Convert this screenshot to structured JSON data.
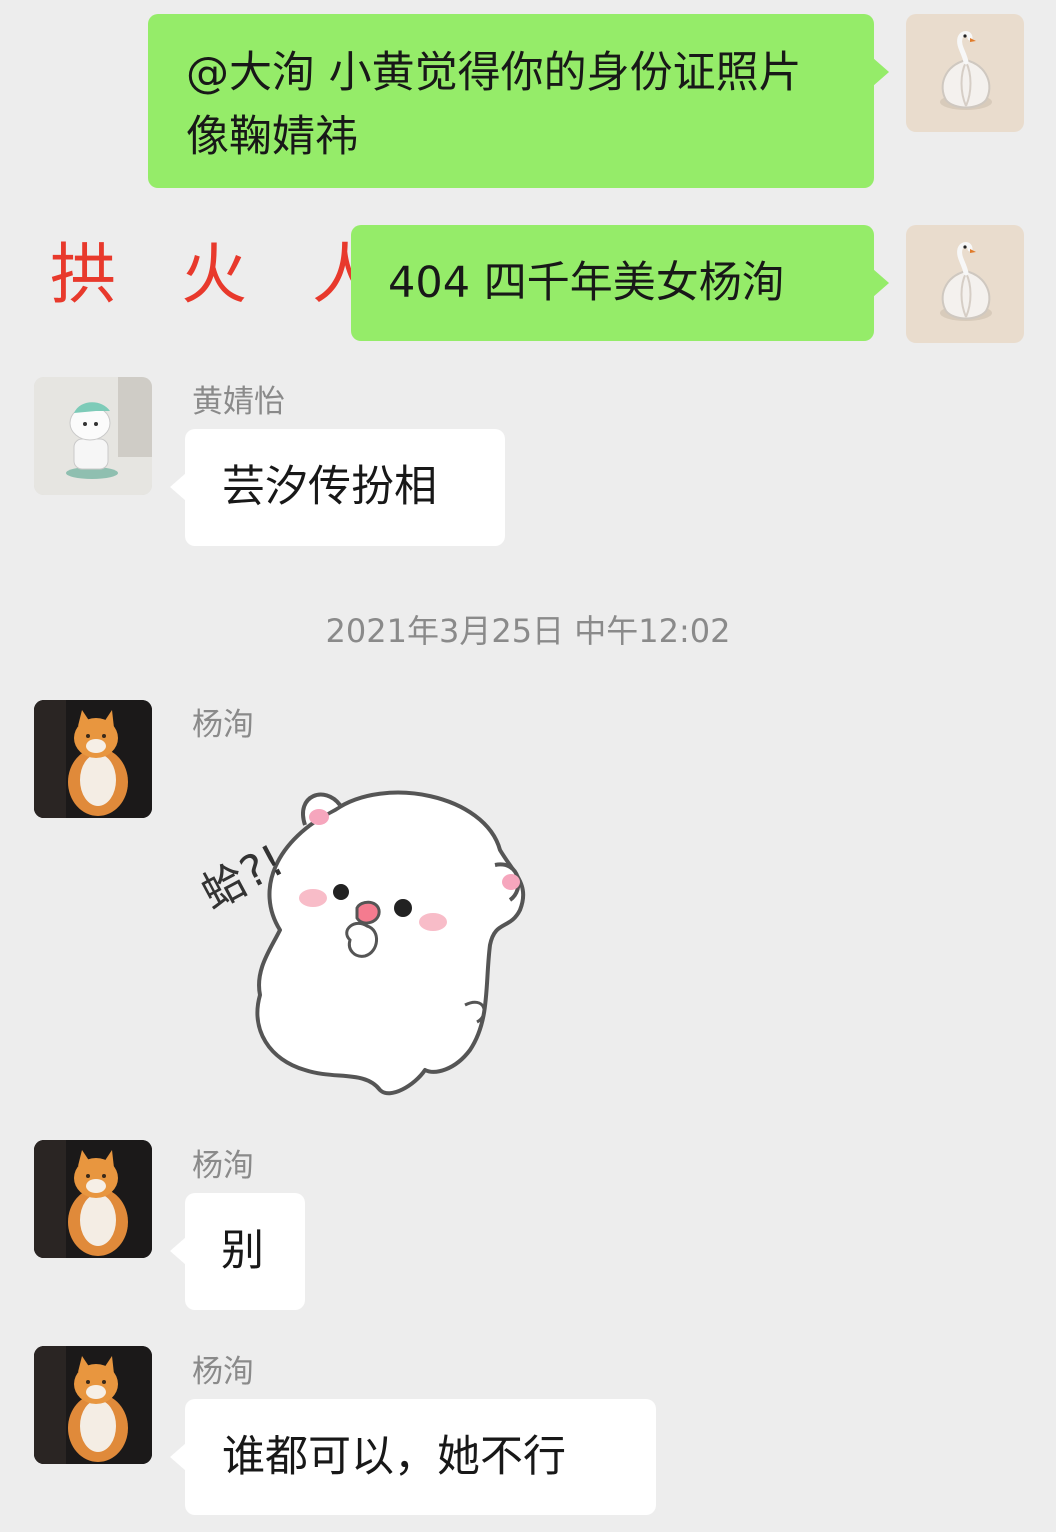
{
  "messages": {
    "m1": {
      "text": "@大洵  小黄觉得你的身份证照片像鞠婧祎"
    },
    "m2": {
      "text": "404 四千年美女杨洵"
    },
    "m3": {
      "sender": "黄婧怡",
      "text": "芸汐传扮相"
    },
    "m4": {
      "sender": "杨洵",
      "sticker_text": "蛤?!"
    },
    "m5": {
      "sender": "杨洵",
      "text": "别"
    },
    "m6": {
      "sender": "杨洵",
      "text": "谁都可以，她不行"
    }
  },
  "overlay_caption": "拱 火 人",
  "timestamp": "2021年3月25日 中午12:02",
  "avatars": {
    "self": "garlic-swan-avatar",
    "huang": "robot-dog-avatar",
    "yang": "orange-cat-avatar"
  },
  "colors": {
    "background": "#ededed",
    "self_bubble": "#95ec69",
    "other_bubble": "#ffffff",
    "caption": "#e8392c",
    "meta_text": "#8a8a8a"
  }
}
